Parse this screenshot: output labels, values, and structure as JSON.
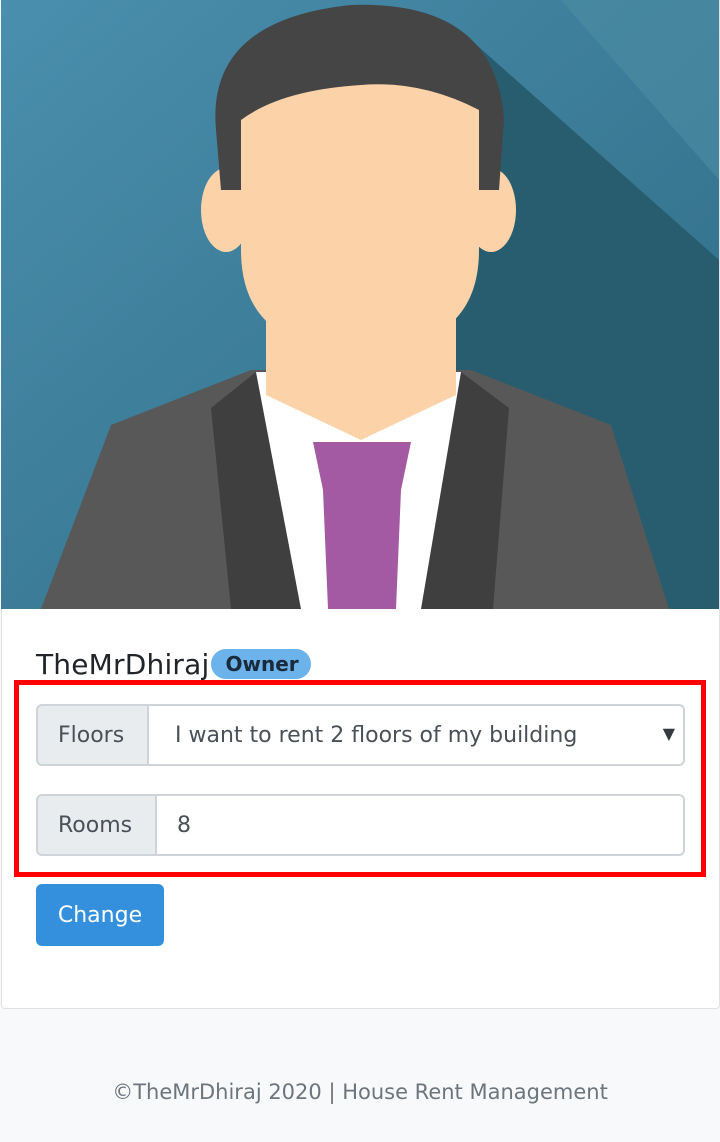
{
  "profile": {
    "avatar_icon": "person-avatar-illustration",
    "name": "TheMrDhiraj",
    "role_badge": "Owner"
  },
  "form": {
    "floors_label": "Floors",
    "floors_selected": "I want to rent 2 floors of my building",
    "rooms_label": "Rooms",
    "rooms_value": "8",
    "submit_label": "Change"
  },
  "footer": {
    "text": "©TheMrDhiraj 2020 | House Rent Management"
  },
  "colors": {
    "primary": "#3490dc",
    "badge": "#6cb2eb",
    "highlight": "#ff0000",
    "avatar_background": "#2a5f73"
  }
}
